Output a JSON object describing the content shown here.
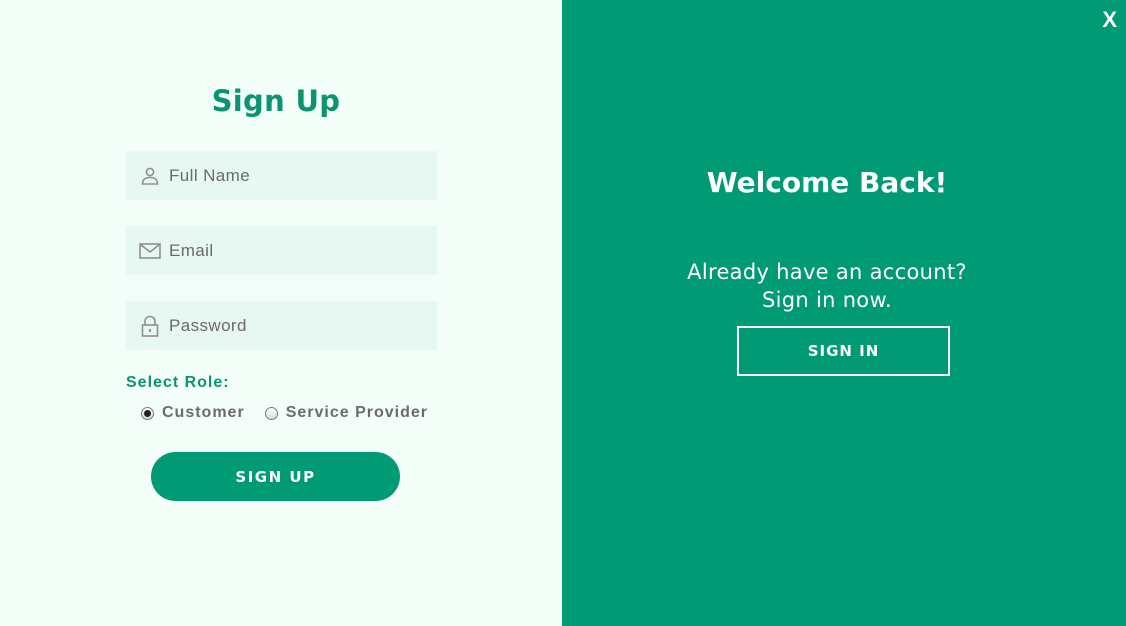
{
  "signup": {
    "title": "Sign Up",
    "fields": {
      "full_name": {
        "placeholder": "Full Name",
        "value": "",
        "icon": "user-icon"
      },
      "email": {
        "placeholder": "Email",
        "value": "",
        "icon": "mail-icon"
      },
      "password": {
        "placeholder": "Password",
        "value": "",
        "icon": "lock-icon"
      }
    },
    "role_label": "Select Role:",
    "roles": [
      {
        "label": "Customer",
        "checked": true
      },
      {
        "label": "Service Provider",
        "checked": false
      }
    ],
    "submit_label": "SIGN UP"
  },
  "overlay": {
    "close_label": "X",
    "title": "Welcome Back!",
    "text": "Already have an account? Sign in now.",
    "button_label": "SIGN IN"
  },
  "colors": {
    "accent": "#009a75",
    "left_background": "#f4fef9",
    "field_background": "#e7f7f1",
    "title_green": "#0b9470"
  }
}
